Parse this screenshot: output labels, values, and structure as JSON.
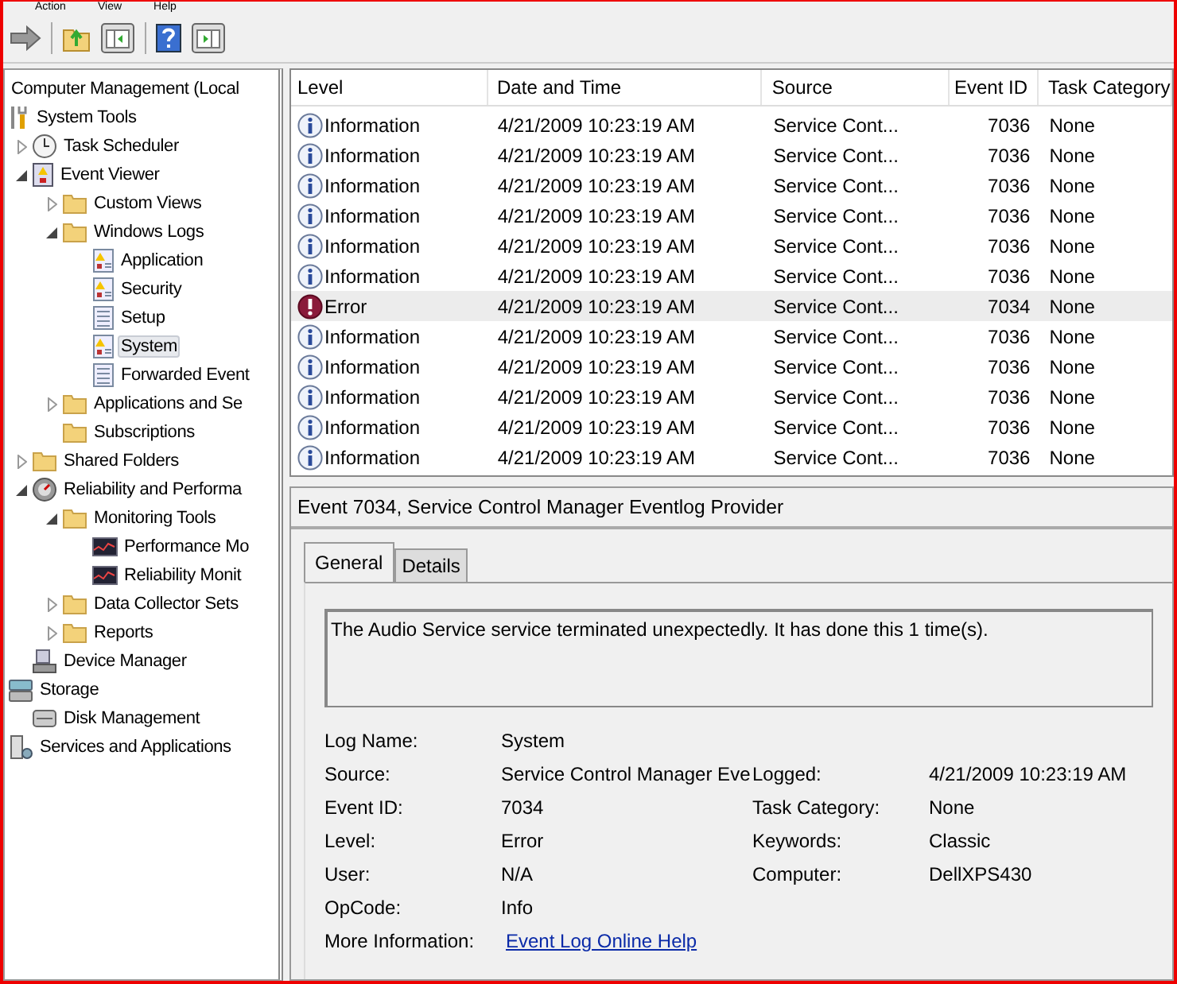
{
  "menu": [
    "Action",
    "View",
    "Help"
  ],
  "tree": [
    {
      "label": "Computer Management (Local",
      "selected": false,
      "children": [
        {
          "label": "System Tools",
          "kind": "tools",
          "selected": false,
          "children": [
            {
              "label": "Task Scheduler",
              "kind": "clock",
              "selected": false,
              "expanded": false
            },
            {
              "label": "Event Viewer",
              "kind": "viewer",
              "selected": false,
              "expanded": true,
              "children": [
                {
                  "label": "Custom Views",
                  "kind": "folder",
                  "selected": false,
                  "expanded": false
                },
                {
                  "label": "Windows Logs",
                  "kind": "folder",
                  "selected": false,
                  "expanded": true,
                  "children": [
                    {
                      "label": "Application",
                      "kind": "log",
                      "selected": false
                    },
                    {
                      "label": "Security",
                      "kind": "log",
                      "selected": false
                    },
                    {
                      "label": "Setup",
                      "kind": "plainlog",
                      "selected": false
                    },
                    {
                      "label": "System",
                      "kind": "log",
                      "selected": true
                    },
                    {
                      "label": "Forwarded Event",
                      "kind": "plainlog",
                      "selected": false
                    }
                  ]
                },
                {
                  "label": "Applications and Se",
                  "kind": "folder",
                  "selected": false,
                  "expanded": false
                },
                {
                  "label": "Subscriptions",
                  "kind": "folder",
                  "selected": false
                }
              ]
            },
            {
              "label": "Shared Folders",
              "kind": "folder",
              "selected": false,
              "expanded": false
            },
            {
              "label": "Reliability and Performa",
              "kind": "gauge",
              "selected": false,
              "expanded": true,
              "children": [
                {
                  "label": "Monitoring Tools",
                  "kind": "folder",
                  "selected": false,
                  "expanded": true,
                  "children": [
                    {
                      "label": "Performance Mo",
                      "kind": "monitor",
                      "selected": false
                    },
                    {
                      "label": "Reliability Monit",
                      "kind": "monitor",
                      "selected": false
                    }
                  ]
                },
                {
                  "label": "Data Collector Sets",
                  "kind": "folder",
                  "selected": false,
                  "expanded": false
                },
                {
                  "label": "Reports",
                  "kind": "folder",
                  "selected": false,
                  "expanded": false
                }
              ]
            },
            {
              "label": "Device Manager",
              "kind": "device",
              "selected": false
            }
          ]
        },
        {
          "label": "Storage",
          "kind": "storage",
          "selected": false,
          "children": [
            {
              "label": "Disk Management",
              "kind": "disk",
              "selected": false
            }
          ]
        },
        {
          "label": "Services and Applications",
          "kind": "services",
          "selected": false
        }
      ]
    }
  ],
  "table": {
    "columns": [
      "Level",
      "Date and Time",
      "Source",
      "Event ID",
      "Task Category"
    ],
    "rows": [
      {
        "kind": "information",
        "level": "Information",
        "date": "4/21/2009 10:23:19 AM",
        "source": "Service Cont...",
        "event_id": "7036",
        "category": "None",
        "selected": false
      },
      {
        "kind": "information",
        "level": "Information",
        "date": "4/21/2009 10:23:19 AM",
        "source": "Service Cont...",
        "event_id": "7036",
        "category": "None",
        "selected": false
      },
      {
        "kind": "information",
        "level": "Information",
        "date": "4/21/2009 10:23:19 AM",
        "source": "Service Cont...",
        "event_id": "7036",
        "category": "None",
        "selected": false
      },
      {
        "kind": "information",
        "level": "Information",
        "date": "4/21/2009 10:23:19 AM",
        "source": "Service Cont...",
        "event_id": "7036",
        "category": "None",
        "selected": false
      },
      {
        "kind": "information",
        "level": "Information",
        "date": "4/21/2009 10:23:19 AM",
        "source": "Service Cont...",
        "event_id": "7036",
        "category": "None",
        "selected": false
      },
      {
        "kind": "information",
        "level": "Information",
        "date": "4/21/2009 10:23:19 AM",
        "source": "Service Cont...",
        "event_id": "7036",
        "category": "None",
        "selected": false
      },
      {
        "kind": "error",
        "level": "Error",
        "date": "4/21/2009 10:23:19 AM",
        "source": "Service Cont...",
        "event_id": "7034",
        "category": "None",
        "selected": true
      },
      {
        "kind": "information",
        "level": "Information",
        "date": "4/21/2009 10:23:19 AM",
        "source": "Service Cont...",
        "event_id": "7036",
        "category": "None",
        "selected": false
      },
      {
        "kind": "information",
        "level": "Information",
        "date": "4/21/2009 10:23:19 AM",
        "source": "Service Cont...",
        "event_id": "7036",
        "category": "None",
        "selected": false
      },
      {
        "kind": "information",
        "level": "Information",
        "date": "4/21/2009 10:23:19 AM",
        "source": "Service Cont...",
        "event_id": "7036",
        "category": "None",
        "selected": false
      },
      {
        "kind": "information",
        "level": "Information",
        "date": "4/21/2009 10:23:19 AM",
        "source": "Service Cont...",
        "event_id": "7036",
        "category": "None",
        "selected": false
      },
      {
        "kind": "information",
        "level": "Information",
        "date": "4/21/2009 10:23:19 AM",
        "source": "Service Cont...",
        "event_id": "7036",
        "category": "None",
        "selected": false
      }
    ]
  },
  "detail": {
    "title": "Event 7034, Service Control Manager Eventlog Provider",
    "tabs": [
      {
        "label": "General",
        "selected": true
      },
      {
        "label": "Details",
        "selected": false
      }
    ],
    "message": "The Audio Service service terminated unexpectedly.  It has done this 1 time(s).",
    "fields": [
      {
        "label": "Log Name:",
        "value": "System"
      },
      {
        "label": "Source:",
        "value": "Service Control Manager Eve",
        "label_2": "Logged:",
        "value_2": "4/21/2009 10:23:19 AM"
      },
      {
        "label": "Event ID:",
        "value": "7034",
        "label_2": "Task Category:",
        "value_2": "None"
      },
      {
        "label": "Level:",
        "value": "Error",
        "label_2": "Keywords:",
        "value_2": "Classic"
      },
      {
        "label": "User:",
        "value": "N/A",
        "label_2": "Computer:",
        "value_2": "DellXPS430"
      },
      {
        "label": "OpCode:",
        "value": "Info"
      },
      {
        "label": "More Information:",
        "link": "Event Log Online Help"
      }
    ]
  }
}
